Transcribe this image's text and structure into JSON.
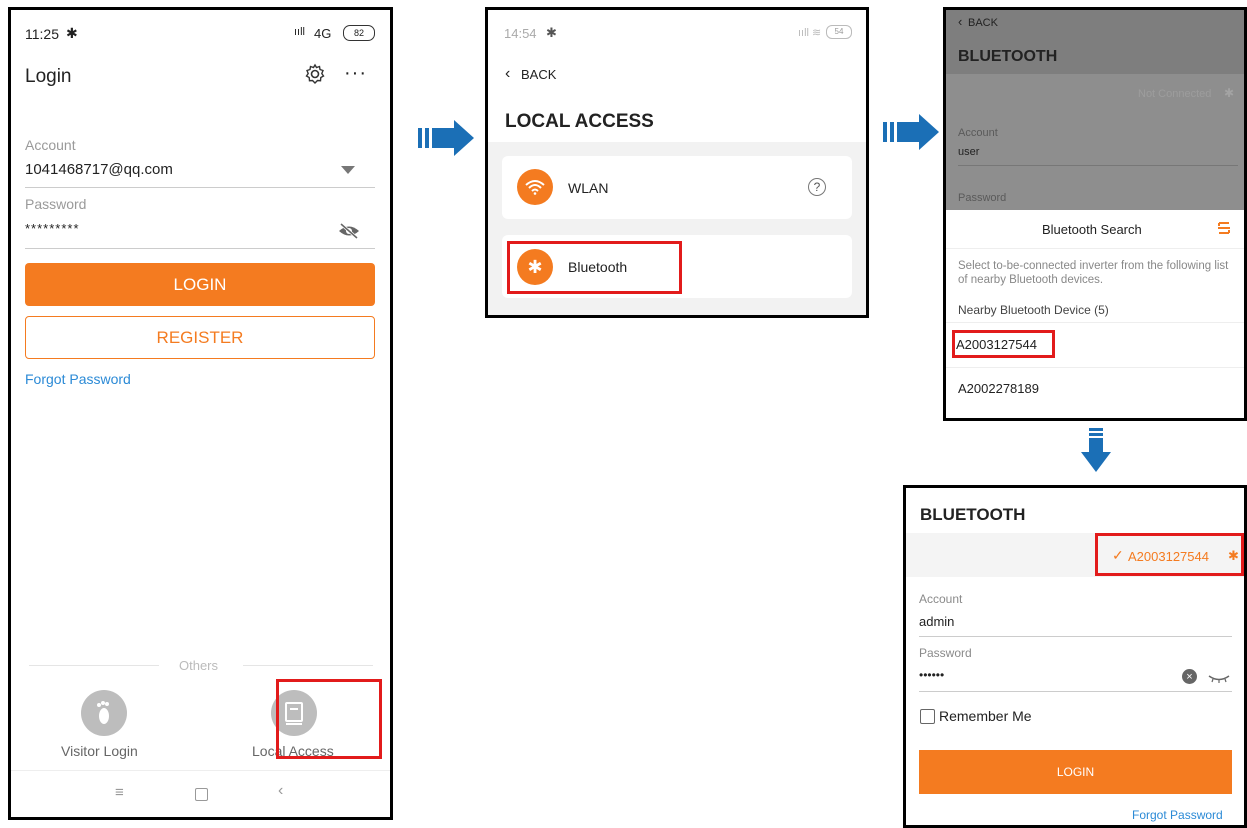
{
  "phone1": {
    "status_time": "11:25",
    "status_signal": "4G",
    "status_battery": "82",
    "title": "Login",
    "account_label": "Account",
    "account_value": "1041468717@qq.com",
    "password_label": "Password",
    "password_value": "*********",
    "login_button": "LOGIN",
    "register_button": "REGISTER",
    "forgot_link": "Forgot Password",
    "others_label": "Others",
    "visitor_login": "Visitor Login",
    "local_access": "Local Access"
  },
  "phone2": {
    "status_time": "14:54",
    "status_battery": "54",
    "back_label": "BACK",
    "title": "LOCAL ACCESS",
    "wlan_label": "WLAN",
    "bluetooth_label": "Bluetooth"
  },
  "phone3": {
    "back_label": "BACK",
    "title": "BLUETOOTH",
    "not_connected": "Not Connected",
    "account_label": "Account",
    "account_value": "user",
    "password_label": "Password",
    "sheet_title": "Bluetooth Search",
    "instruction": "Select to-be-connected inverter from the following list of nearby Bluetooth devices.",
    "nearby_header": "Nearby Bluetooth Device (5)",
    "devices": [
      "A2003127544",
      "A2002278189"
    ]
  },
  "phone4": {
    "title": "BLUETOOTH",
    "connected_device": "A2003127544",
    "account_label": "Account",
    "account_value": "admin",
    "password_label": "Password",
    "password_value": "••••••",
    "remember_me": "Remember Me",
    "login_button": "LOGIN",
    "forgot_link": "Forgot Password"
  },
  "colors": {
    "accent_orange": "#f47b20",
    "link_blue": "#2b8ad6",
    "arrow_blue": "#1b6fb6",
    "highlight_red": "#e21b1b"
  }
}
